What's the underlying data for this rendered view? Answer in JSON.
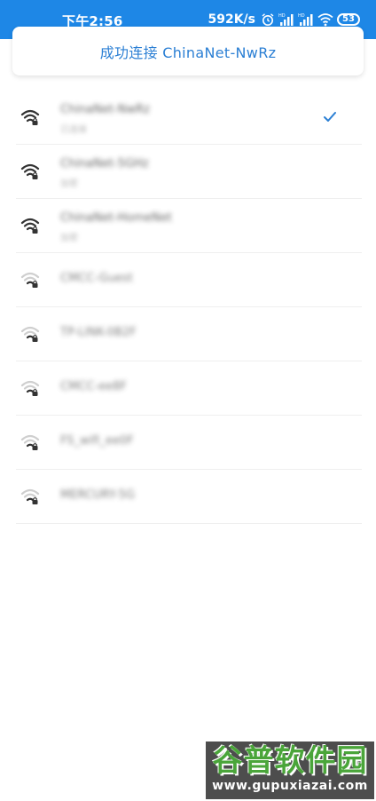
{
  "status_bar": {
    "time": "下午2:56",
    "network_speed": "592K/s",
    "battery": "53",
    "background_color": "#1e87e6",
    "icons": [
      "alarm-icon",
      "signal-hd-icon",
      "signal-hd-icon",
      "wifi-icon",
      "battery-icon"
    ]
  },
  "connection": {
    "message": "成功连接 ChinaNet-NwRz",
    "color": "#2b7fd4"
  },
  "wifi_list": [
    {
      "name": "ChinaNet-NwRz",
      "sub": "已连接",
      "signal": "strong",
      "connected": true
    },
    {
      "name": "ChinaNet-5GHz",
      "sub": "加密",
      "signal": "strong",
      "connected": false
    },
    {
      "name": "ChinaNet-HomeNet",
      "sub": "加密",
      "signal": "strong",
      "connected": false
    },
    {
      "name": "CMCC-Guest",
      "sub": "",
      "signal": "weak",
      "connected": false
    },
    {
      "name": "TP-LINK-0B2F",
      "sub": "",
      "signal": "weak",
      "connected": false
    },
    {
      "name": "CMCC-ee8F",
      "sub": "",
      "signal": "weak",
      "connected": false
    },
    {
      "name": "FS_wifi_ee0F",
      "sub": "",
      "signal": "weak",
      "connected": false
    },
    {
      "name": "MERCURY-5G",
      "sub": "",
      "signal": "weak",
      "connected": false
    }
  ],
  "watermark": {
    "title": "谷普软件园",
    "url": "www.gupuxiazai.com"
  }
}
